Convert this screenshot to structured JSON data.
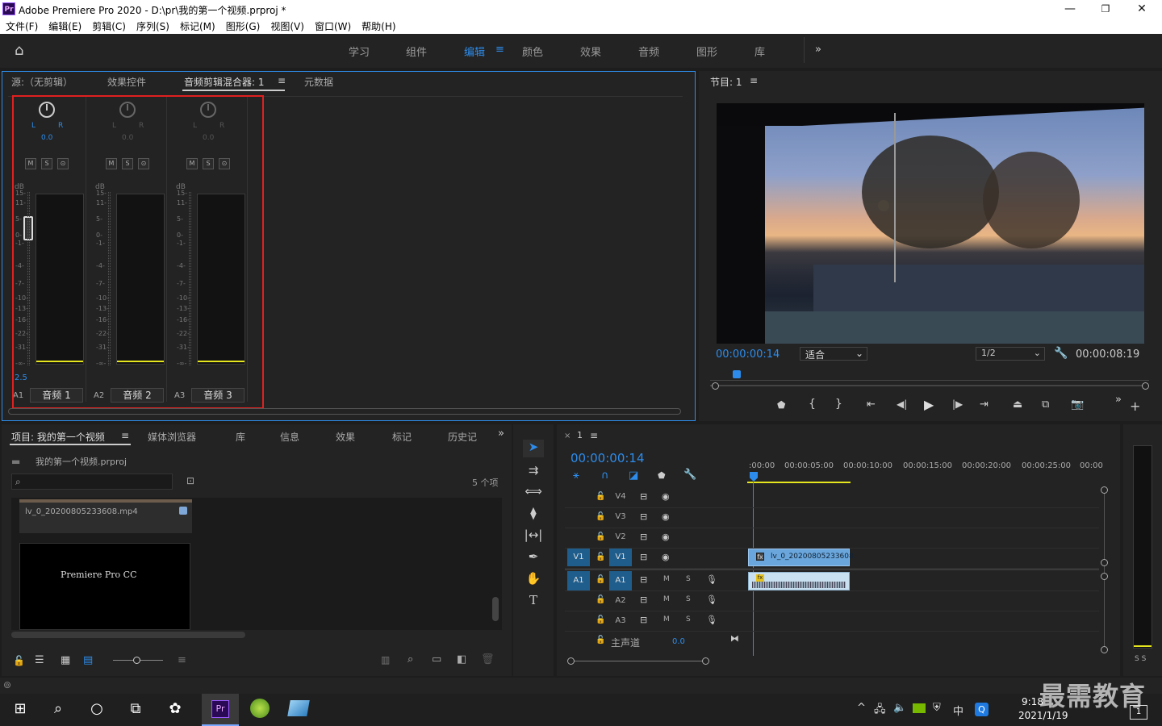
{
  "window": {
    "title": "Adobe Premiere Pro 2020 - D:\\pr\\我的第一个视频.prproj *",
    "logo": "Pr"
  },
  "menu": [
    "文件(F)",
    "编辑(E)",
    "剪辑(C)",
    "序列(S)",
    "标记(M)",
    "图形(G)",
    "视图(V)",
    "窗口(W)",
    "帮助(H)"
  ],
  "workspaces": [
    "学习",
    "组件",
    "编辑",
    "颜色",
    "效果",
    "音频",
    "图形",
    "库"
  ],
  "active_workspace": "编辑",
  "source_panel": {
    "tabs": [
      "源:（无剪辑）",
      "效果控件",
      "音频剪辑混合器: 1",
      "元数据"
    ],
    "channels": [
      {
        "id": "A1",
        "name": "音频 1",
        "pan": "0.0",
        "active": true
      },
      {
        "id": "A2",
        "name": "音频 2",
        "pan": "0.0",
        "active": false
      },
      {
        "id": "A3",
        "name": "音频 3",
        "pan": "0.0",
        "active": false
      }
    ],
    "pan_l": "L",
    "pan_r": "R",
    "db_label": "dB",
    "scale": [
      "15",
      "11",
      "5",
      "0",
      "-1",
      "-4",
      "-7",
      "-10",
      "-13",
      "-16",
      "-22",
      "-31",
      "-∞"
    ],
    "gain_readout": "2.5",
    "btn_m": "M",
    "btn_s": "S",
    "btn_r": "⊙"
  },
  "program": {
    "title": "节目: 1",
    "timecode": "00:00:00:14",
    "fit": "适合",
    "resolution": "1/2",
    "duration": "00:00:08:19",
    "playhead_fraction": 0.06
  },
  "project": {
    "tabs": [
      "项目: 我的第一个视频",
      "媒体浏览器",
      "库",
      "信息",
      "效果",
      "标记",
      "历史记"
    ],
    "file": "我的第一个视频.prproj",
    "count": "5 个项",
    "items": [
      "lv_0_20200805233608.mp4"
    ],
    "title_card": "Premiere Pro CC"
  },
  "timeline": {
    "tab": "1",
    "timecode": "00:00:00:14",
    "ruler": [
      ":00:00",
      "00:00:05:00",
      "00:00:10:00",
      "00:00:15:00",
      "00:00:20:00",
      "00:00:25:00",
      "00:00"
    ],
    "video_tracks": [
      "V4",
      "V3",
      "V2",
      "V1"
    ],
    "audio_tracks": [
      "A1",
      "A2",
      "A3"
    ],
    "master": "主声道",
    "master_value": "0.0",
    "clip_name": "lv_0_20200805233608.",
    "fx": "fx"
  },
  "meters": {
    "labels": "S S"
  },
  "taskbar": {
    "time": "9:18",
    "date": "2021/1/19",
    "ime": "中"
  },
  "watermark": "最需教育",
  "colors": {
    "accent": "#2d8ceb",
    "highlight_box": "#e02020",
    "clip_video": "#6aa6dc",
    "clip_audio": "#c8e0ef",
    "yellow": "#e6e61e"
  }
}
